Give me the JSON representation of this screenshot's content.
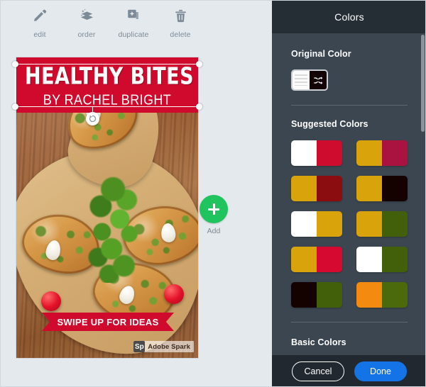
{
  "toolbar": {
    "items": [
      {
        "label": "edit",
        "icon": "pencil-icon"
      },
      {
        "label": "order",
        "icon": "layers-icon"
      },
      {
        "label": "duplicate",
        "icon": "duplicate-icon"
      },
      {
        "label": "delete",
        "icon": "trash-icon"
      }
    ]
  },
  "canvas": {
    "headline": "HEALTHY BITES",
    "subheadline": "BY RACHEL BRIGHT",
    "ribbon_label": "SWIPE UP FOR IDEAS",
    "watermark_logo": "Sp",
    "watermark_text": "Adobe Spark",
    "rotate_icon": "rotate-icon",
    "banner_color": "#CF0A2C",
    "add": {
      "label": "Add",
      "icon": "plus-icon",
      "color": "#1FC45E"
    }
  },
  "panel": {
    "title": "Colors",
    "original_section_label": "Original Color",
    "original_swatch": {
      "left_color": "#FBFBFB",
      "right_color": "#120305",
      "icon": "shuffle-icon",
      "selected": true
    },
    "suggested_section_label": "Suggested Colors",
    "suggested_colors": [
      {
        "left": "#FFFFFF",
        "right": "#CE0C2D"
      },
      {
        "left": "#D9A40B",
        "right": "#AA1240"
      },
      {
        "left": "#D9A40B",
        "right": "#8C0D10"
      },
      {
        "left": "#D9A40B",
        "right": "#130200"
      },
      {
        "left": "#FFFFFF",
        "right": "#D9A40B"
      },
      {
        "left": "#D9A40B",
        "right": "#426009"
      },
      {
        "left": "#D9A40B",
        "right": "#D60A31"
      },
      {
        "left": "#FFFFFF",
        "right": "#426009"
      },
      {
        "left": "#130200",
        "right": "#426009"
      },
      {
        "left": "#F58A11",
        "right": "#4A6A0C"
      }
    ],
    "basic_section_label": "Basic Colors",
    "footer": {
      "cancel_label": "Cancel",
      "done_label": "Done",
      "done_color": "#1473E6"
    }
  }
}
